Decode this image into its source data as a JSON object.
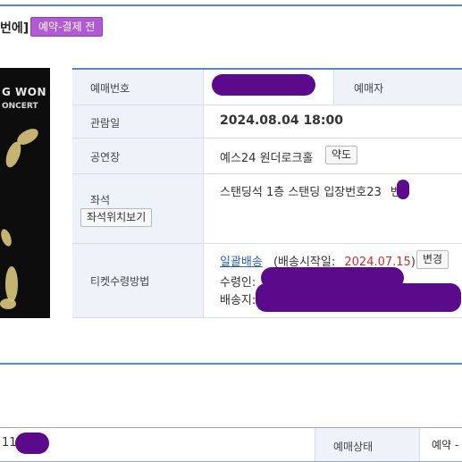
{
  "header": {
    "title": "번에]",
    "status_badge": "예약-결제 전"
  },
  "poster": {
    "line1": "G WON",
    "line2": "ONCERT"
  },
  "details": {
    "booking_number_label": "예매번호",
    "booker_label": "예매자",
    "show_date_label": "관람일",
    "show_date_value": "2024.08.04 18:00",
    "venue_label": "공연장",
    "venue_value": "예스24 원더로크홀",
    "map_button": "약도",
    "seat_label": "좌석",
    "seat_view_button": "좌석위치보기",
    "seat_value_prefix": "스탠딩석 1층 스탠딩 입장번호23",
    "seat_value_suffix": "번",
    "ticket_method_label": "티켓수령방법",
    "delivery_link": "일괄배송",
    "delivery_start_prefix": "(배송시작일:",
    "delivery_start_date": "2024.07.15",
    "delivery_start_suffix": ")",
    "change_button": "변경",
    "recipient_label": "수령인:",
    "address_label": "배송지:"
  },
  "bottom_row": {
    "left_value": "11",
    "status_label": "예매상태",
    "status_value": "예약 -"
  },
  "colors": {
    "accent_blue": "#5a86c8",
    "badge_purple": "#b05ad6",
    "redaction_purple": "#5a0a8a",
    "label_bg": "#eef3fa"
  }
}
